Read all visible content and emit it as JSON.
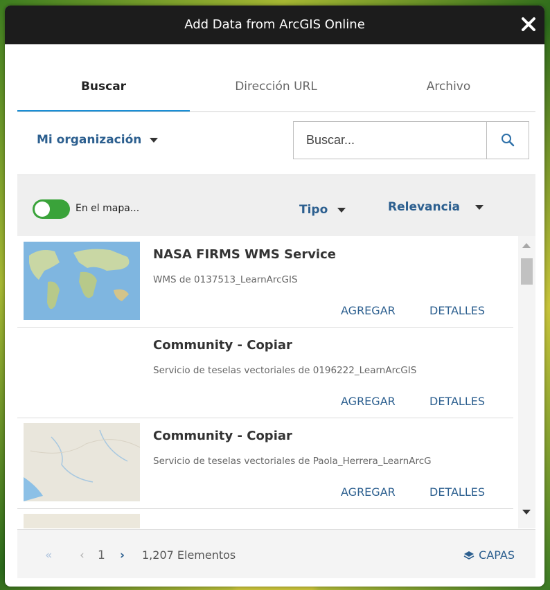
{
  "dialog": {
    "title": "Add Data from ArcGIS Online"
  },
  "tabs": [
    {
      "label": "Buscar",
      "active": true
    },
    {
      "label": "Dirección URL",
      "active": false
    },
    {
      "label": "Archivo",
      "active": false
    }
  ],
  "filter": {
    "organization": "Mi organización",
    "search_placeholder": "Buscar...",
    "on_map_label": "En el mapa...",
    "on_map_enabled": true,
    "type_label": "Tipo",
    "sort_label": "Relevancia"
  },
  "results": [
    {
      "title": "NASA FIRMS WMS Service",
      "description": "WMS de 0137513_LearnArcGIS",
      "add_label": "AGREGAR",
      "details_label": "DETALLES",
      "thumbnail": "world-map-thumbnail"
    },
    {
      "title": "Community - Copiar",
      "description": "Servicio de teselas vectoriales de 0196222_LearnArcGIS",
      "add_label": "AGREGAR",
      "details_label": "DETALLES",
      "thumbnail": "none"
    },
    {
      "title": "Community - Copiar",
      "description": "Servicio de teselas vectoriales de Paola_Herrera_LearnArcG",
      "add_label": "AGREGAR",
      "details_label": "DETALLES",
      "thumbnail": "basemap-thumbnail"
    }
  ],
  "footer": {
    "first_icon": "«",
    "prev_icon": "‹",
    "page": "1",
    "next_icon": "›",
    "count": "1,207 Elementos",
    "layers_label": "CAPAS"
  },
  "colors": {
    "accent": "#1a8fd6",
    "link": "#2c5f8f",
    "toggle": "#3aa33a",
    "titlebar": "#1c1c1c"
  }
}
